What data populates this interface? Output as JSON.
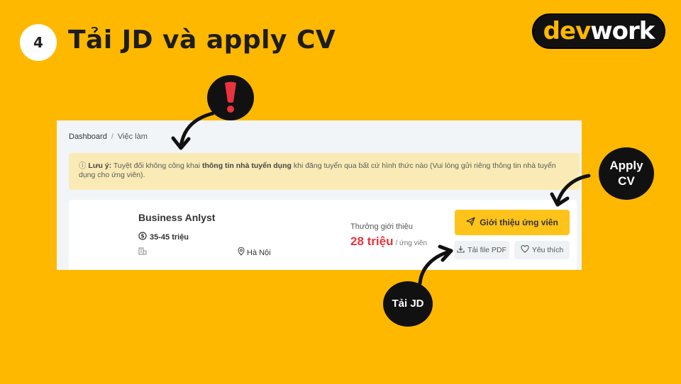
{
  "slide": {
    "step_number": "4",
    "title": "Tải JD và apply CV",
    "logo": {
      "dev": "dev",
      "work": "work"
    }
  },
  "breadcrumb": {
    "home": "Dashboard",
    "separator": "/",
    "current": "Việc làm"
  },
  "notice": {
    "prefix": "Lưu ý:",
    "text_1": " Tuyệt đối không công khai ",
    "bold": "thông tin nhà tuyển dụng",
    "text_2": " khi đăng tuyển qua bất cứ hình thức nào (Vui lòng gửi riêng thông tin nhà tuyển dụng cho ứng viên)."
  },
  "job": {
    "title": "Business Anlyst",
    "salary": "35-45 triệu",
    "location": "Hà Nội",
    "bonus_label": "Thưởng giới thiệu",
    "bonus_amount": "28 triệu",
    "bonus_unit": "/ ứng viên"
  },
  "actions": {
    "refer_label": "Giới thiệu ứng viên",
    "pdf_label": "Tải file PDF",
    "like_label": "Yêu thích"
  },
  "callouts": {
    "exclaim": "!",
    "apply_line1": "Apply",
    "apply_line2": "CV",
    "tai_jd": "Tải JD"
  },
  "colors": {
    "background": "#FFB800",
    "accent_red": "#E7343F",
    "button_yellow": "#FFC31A",
    "notice_bg": "#FAEBB6"
  },
  "icons": {
    "salary": "dollar-circle-icon",
    "company": "building-icon",
    "location": "map-pin-icon",
    "refer": "send-icon",
    "pdf": "download-icon",
    "like": "heart-icon",
    "notice": "info-icon"
  }
}
